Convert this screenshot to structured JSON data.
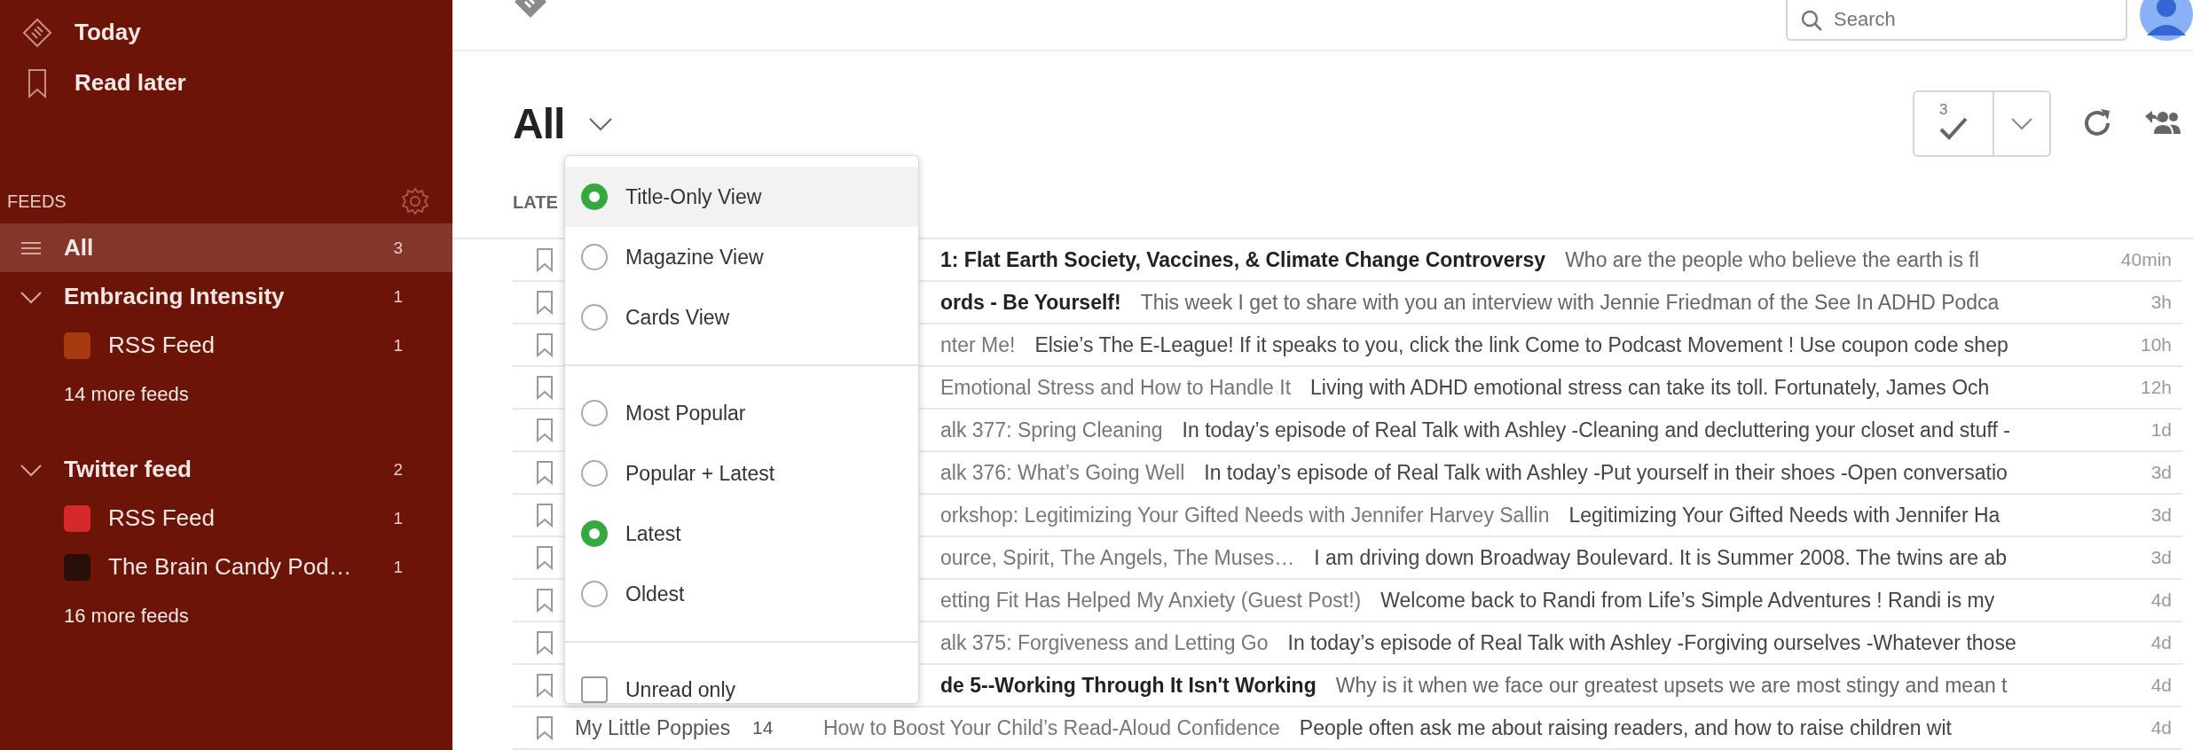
{
  "sidebar": {
    "nav": [
      {
        "kind": "today",
        "label": "Today"
      },
      {
        "kind": "later",
        "label": "Read later"
      }
    ],
    "feeds_heading": "FEEDS",
    "feeds": [
      {
        "kind": "all",
        "label": "All",
        "count": "3",
        "selected": true
      },
      {
        "kind": "group",
        "label": "Embracing Intensity",
        "count": "1",
        "expanded": true,
        "selected": false,
        "children": [
          {
            "label": "RSS Feed",
            "count": "1",
            "color": "#a83a10"
          }
        ],
        "more": "14 more feeds"
      },
      {
        "kind": "group",
        "label": "Twitter feed",
        "count": "2",
        "expanded": true,
        "selected": false,
        "children": [
          {
            "label": "RSS Feed",
            "count": "1",
            "color": "#d42a2a"
          },
          {
            "label": "The Brain Candy Pod…",
            "count": "1",
            "color": "#2a0f08"
          }
        ],
        "more": "16 more feeds"
      }
    ]
  },
  "search": {
    "placeholder": "Search"
  },
  "header": {
    "title": "All",
    "mark_read_count": "3",
    "section_label": "LATE"
  },
  "menu": {
    "sections": [
      {
        "items": [
          {
            "kind": "radio",
            "label": "Title-Only View",
            "selected": true,
            "highlighted": true
          },
          {
            "kind": "radio",
            "label": "Magazine View",
            "selected": false,
            "highlighted": false
          },
          {
            "kind": "radio",
            "label": "Cards View",
            "selected": false,
            "highlighted": false
          }
        ]
      },
      {
        "items": [
          {
            "kind": "radio",
            "label": "Most Popular",
            "selected": false,
            "highlighted": false
          },
          {
            "kind": "radio",
            "label": "Popular + Latest",
            "selected": false,
            "highlighted": false
          },
          {
            "kind": "radio",
            "label": "Latest",
            "selected": true,
            "highlighted": false
          },
          {
            "kind": "radio",
            "label": "Oldest",
            "selected": false,
            "highlighted": false
          }
        ]
      },
      {
        "items": [
          {
            "kind": "checkbox",
            "label": "Unread only",
            "checked": false,
            "highlighted": false
          }
        ]
      }
    ]
  },
  "articles": [
    {
      "title": "1: Flat Earth Society, Vaccines, & Climate Change Controversy",
      "summary": "Who are the people who believe the earth is fl",
      "time": "40min",
      "unread": true
    },
    {
      "title": "ords - Be Yourself!",
      "summary": "This week I get to share with you an interview with Jennie Friedman of the See In ADHD Podca",
      "time": "3h",
      "unread": true
    },
    {
      "title": "nter Me!",
      "summary": "Elsie’s The E-League! If it speaks to you, click the link Come to Podcast Movement ! Use coupon code shep",
      "time": "10h",
      "unread": false
    },
    {
      "title": "Emotional Stress and How to Handle It",
      "summary": "Living with ADHD emotional stress can take its toll. Fortunately, James Och",
      "time": "12h",
      "unread": false
    },
    {
      "title": "alk 377: Spring Cleaning",
      "summary": "In today’s episode of Real Talk with Ashley -Cleaning and decluttering your closet and stuff -",
      "time": "1d",
      "unread": false
    },
    {
      "title": "alk 376: What’s Going Well",
      "summary": "In today’s episode of Real Talk with Ashley -Put yourself in their shoes -Open conversatio",
      "time": "3d",
      "unread": false
    },
    {
      "title": "orkshop: Legitimizing Your Gifted Needs with Jennifer Harvey Sallin",
      "summary": "Legitimizing Your Gifted Needs with Jennifer Ha",
      "time": "3d",
      "unread": false
    },
    {
      "title": "ource, Spirit, The Angels, The Muses…",
      "summary": "I am driving down Broadway Boulevard. It is Summer 2008. The twins are ab",
      "time": "3d",
      "unread": false
    },
    {
      "title": "etting Fit Has Helped My Anxiety (Guest Post!)",
      "summary": "Welcome back to Randi from Life’s Simple Adventures ! Randi is my",
      "time": "4d",
      "unread": false
    },
    {
      "title": "alk 375: Forgiveness and Letting Go",
      "summary": "In today’s episode of Real Talk with Ashley -Forgiving ourselves -Whatever those",
      "time": "4d",
      "unread": false
    },
    {
      "title": "de 5--Working Through It Isn't Working",
      "summary": "Why is it when we face our greatest upsets we are most stingy and mean t",
      "time": "4d",
      "unread": true
    },
    {
      "source": "My Little Poppies",
      "count": "14",
      "title": "How to Boost Your Child’s Read-Aloud Confidence",
      "summary": "People often ask me about raising readers, and how to raise children wit",
      "time": "4d",
      "unread": false
    }
  ]
}
